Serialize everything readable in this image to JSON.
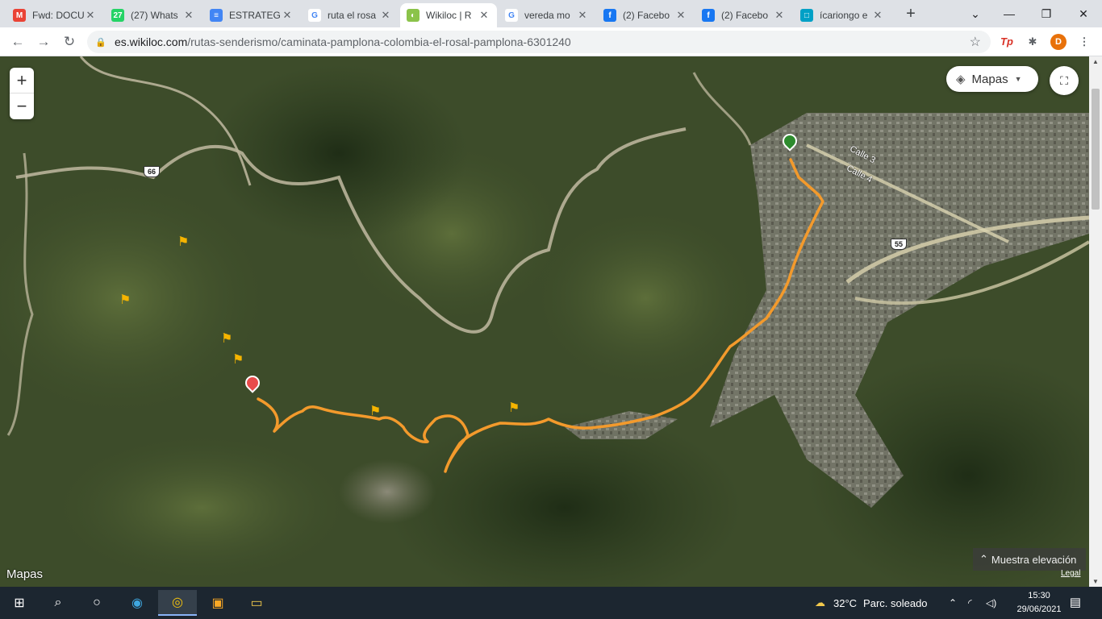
{
  "browser": {
    "tabs": [
      {
        "title": "Fwd: DOCU",
        "favicon": "gmail-icon",
        "color": "#ea4335",
        "glyph": "M"
      },
      {
        "title": "(27) Whats",
        "favicon": "whatsapp-icon",
        "color": "#25d366",
        "glyph": "27"
      },
      {
        "title": "ESTRATEGI",
        "favicon": "google-docs-icon",
        "color": "#4285f4",
        "glyph": "≡"
      },
      {
        "title": "ruta el rosa",
        "favicon": "google-icon",
        "color": "#ffffff",
        "glyph": "G"
      },
      {
        "title": "Wikiloc | R",
        "favicon": "wikiloc-icon",
        "color": "#8bc34a",
        "glyph": "◐"
      },
      {
        "title": "vereda mo",
        "favicon": "google-icon",
        "color": "#ffffff",
        "glyph": "G"
      },
      {
        "title": "(2) Facebo",
        "favicon": "facebook-icon",
        "color": "#1877f2",
        "glyph": "f"
      },
      {
        "title": "(2) Facebo",
        "favicon": "facebook-icon",
        "color": "#1877f2",
        "glyph": "f"
      },
      {
        "title": "ícariongo e",
        "favicon": "web-icon",
        "color": "#00a0c6",
        "glyph": "□"
      }
    ],
    "active_tab": 4,
    "url_domain": "es.wikiloc.com",
    "url_path": "/rutas-senderismo/caminata-pamplona-colombia-el-rosal-pamplona-6301240",
    "profile_initial": "D",
    "extension_label": "Tp"
  },
  "map": {
    "zoom_in": "+",
    "zoom_out": "−",
    "map_type": "Mapas",
    "brand": "Mapas",
    "elevation_button": "Muestra elevación",
    "legal": "Legal",
    "road_labels": [
      {
        "text": "66"
      },
      {
        "text": "55"
      },
      {
        "text": "Calle 3"
      },
      {
        "text": "Calle 4"
      }
    ],
    "route_color": "#f39a2c",
    "start_color": "#2e8b2e",
    "end_color": "#e84b4b"
  },
  "taskbar": {
    "weather_temp": "32°C",
    "weather_desc": "Parc. soleado",
    "time": "15:30",
    "date": "29/06/2021"
  }
}
